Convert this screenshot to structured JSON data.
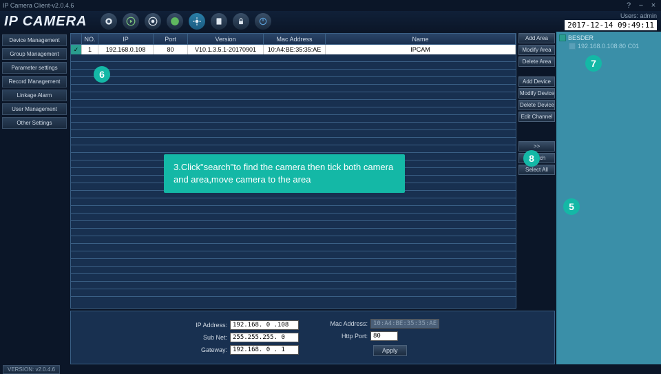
{
  "window": {
    "title": "IP Camera Client-v2.0.4.6"
  },
  "header": {
    "logo": "IP CAMERA",
    "users_label": "Users: admin",
    "datetime": "2017-12-14 09:49:11"
  },
  "sidebar": {
    "items": [
      "Device Management",
      "Group Management",
      "Parameter settings",
      "Record Management",
      "Linkage Alarm",
      "User Management",
      "Other Settings"
    ]
  },
  "table": {
    "headers": {
      "no": "NO.",
      "ip": "IP",
      "port": "Port",
      "version": "Version",
      "mac": "Mac Address",
      "name": "Name"
    },
    "rows": [
      {
        "no": "1",
        "ip": "192.168.0.108",
        "port": "80",
        "version": "V10.1.3.5.1-20170901",
        "mac": "10:A4:BE:35:35:AE",
        "name": "IPCAM"
      }
    ]
  },
  "actions": {
    "add_area": "Add Area",
    "modify_area": "Modify Area",
    "delete_area": "Delete Area",
    "add_device": "Add Device",
    "modify_device": "Modify Device",
    "delete_device": "Delete Device",
    "edit_channel": "Edit Channel",
    "move": ">>",
    "search": "Search",
    "select_all": "Select All"
  },
  "network": {
    "ip_label": "IP Address:",
    "ip_value": "192.168. 0 .108",
    "subnet_label": "Sub Net:",
    "subnet_value": "255.255.255. 0",
    "gateway_label": "Gateway:",
    "gateway_value": "192.168. 0 . 1",
    "mac_label": "Mac Address:",
    "mac_value": "10:A4:BE:35:35:AE",
    "http_label": "Http Port:",
    "http_value": "80",
    "apply": "Apply"
  },
  "tree": {
    "root": "BESDER",
    "child": "192.168.0.108:80 C01"
  },
  "footer": {
    "version": "VERSION: v2.0.4.6"
  },
  "annotations": {
    "n5": "5",
    "n6": "6",
    "n7": "7",
    "n8": "8",
    "tooltip": "3.Click\"search\"to find the camera then tick both camera and area,move camera to the area"
  }
}
